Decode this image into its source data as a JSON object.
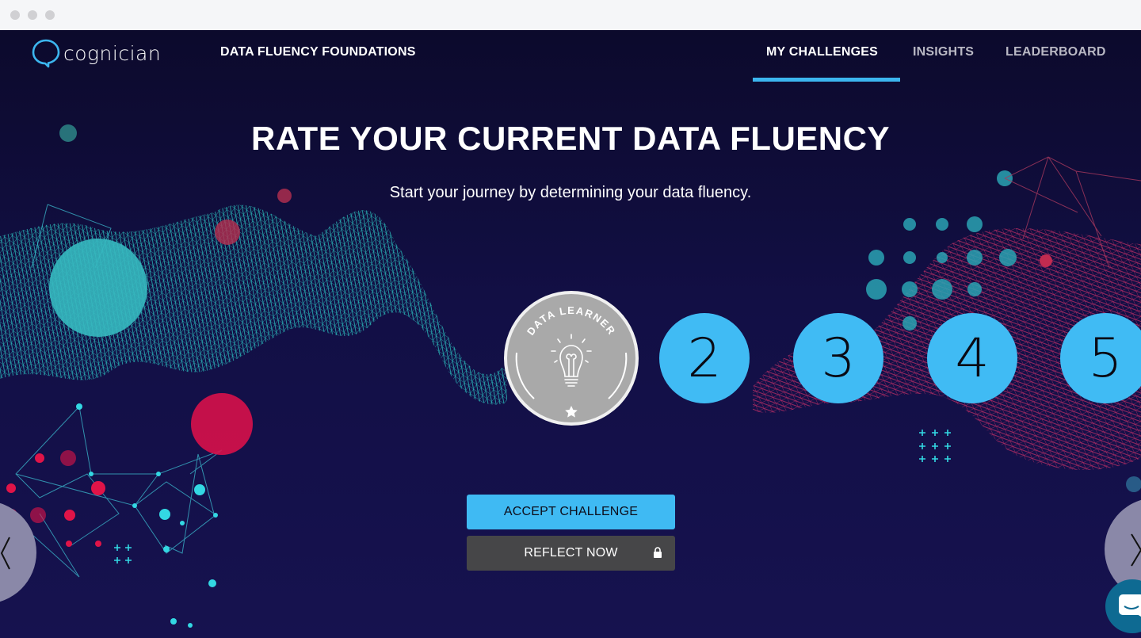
{
  "window": {
    "controls": [
      "close",
      "minimize",
      "maximize"
    ]
  },
  "brand": {
    "name": "cognician",
    "accent": "#3cb6ef"
  },
  "header": {
    "course_title": "DATA FLUENCY FOUNDATIONS",
    "nav": [
      {
        "label": "MY CHALLENGES",
        "active": true
      },
      {
        "label": "INSIGHTS",
        "active": false
      },
      {
        "label": "LEADERBOARD",
        "active": false
      }
    ]
  },
  "main": {
    "title": "RATE YOUR CURRENT DATA FLUENCY",
    "subtitle": "Start your journey by determining your data fluency.",
    "badge": {
      "label": "DATA LEARNER",
      "icon": "lightbulb-icon",
      "star_icon": "star-icon"
    },
    "levels": [
      "2",
      "3",
      "4",
      "5"
    ],
    "accept_button": "ACCEPT CHALLENGE",
    "reflect_button": "REFLECT NOW",
    "reflect_locked": true
  },
  "colors": {
    "background": "#120f45",
    "level_circle": "#40bbf4",
    "accept_button": "#3fbaf3",
    "reflect_button": "#464648",
    "badge": "#a9a9a9"
  }
}
